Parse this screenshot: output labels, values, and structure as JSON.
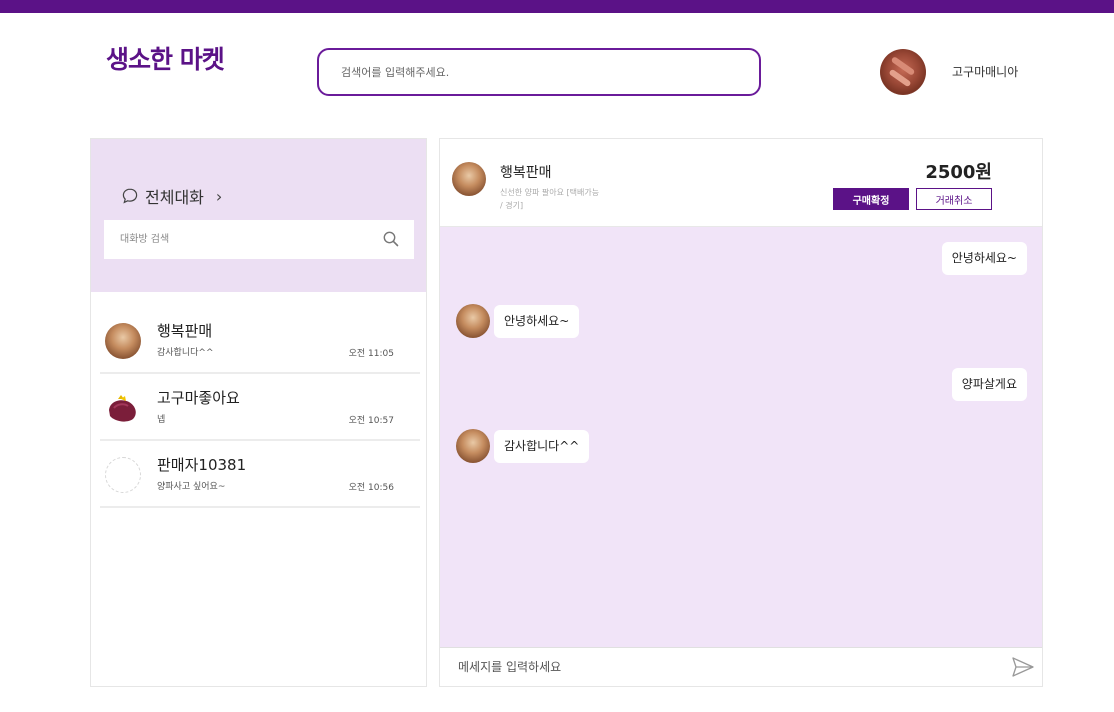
{
  "header": {
    "logo_text": "생소한 마켓",
    "search_placeholder": "검색어를 입력해주세요.",
    "user_name": "고구마매니아"
  },
  "sidebar": {
    "all_chats_label": "전체대화",
    "room_search_placeholder": "대화방 검색",
    "chats": [
      {
        "name": "행복판매",
        "preview": "감사합니다^^",
        "time": "오전 11:05",
        "avatar": "seller-photo-avatar"
      },
      {
        "name": "고구마좋아요",
        "preview": "넵",
        "time": "오전 10:57",
        "avatar": "sweet-potato-avatar"
      },
      {
        "name": "판매자10381",
        "preview": "양파사고 싶어요~",
        "time": "오전 10:56",
        "avatar": "empty-avatar"
      }
    ]
  },
  "chat": {
    "seller_name": "행복판매",
    "product_line1": "신선한 양파 팔아요 [택배가능",
    "product_line2": "/ 경기]",
    "price": "2500원",
    "confirm_button": "구매확정",
    "cancel_button": "거래취소",
    "messages": [
      {
        "from": "me",
        "text": "안녕하세요~"
      },
      {
        "from": "other",
        "text": "안녕하세요~"
      },
      {
        "from": "me",
        "text": "양파살게요"
      },
      {
        "from": "other",
        "text": "감사합니다^^"
      }
    ],
    "input_placeholder": "메세지를 입력하세요"
  },
  "colors": {
    "brand": "#5b1287",
    "chat_background": "#f1e4f8",
    "sidebar_header_background": "#ecdff3"
  },
  "icons": [
    "chat-bubble-icon",
    "chevron-right-icon",
    "search-icon",
    "send-icon"
  ]
}
